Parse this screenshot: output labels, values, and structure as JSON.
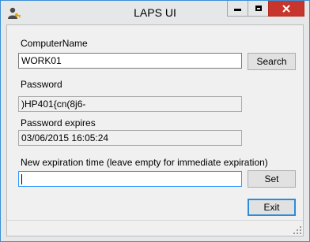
{
  "window": {
    "title": "LAPS UI"
  },
  "form": {
    "computer_name_label": "ComputerName",
    "computer_name_value": "WORK01",
    "search_button": "Search",
    "password_label": "Password",
    "password_value": ")HP401{cn(8j6-",
    "expires_label": "Password expires",
    "expires_value": "03/06/2015 16:05:24",
    "new_expiration_label": "New expiration time (leave empty for immediate expiration)",
    "new_expiration_value": "",
    "set_button": "Set",
    "exit_button": "Exit"
  },
  "colors": {
    "close_button": "#c7352c",
    "focus_border": "#3399ff",
    "window_border": "#3c8fd6"
  }
}
